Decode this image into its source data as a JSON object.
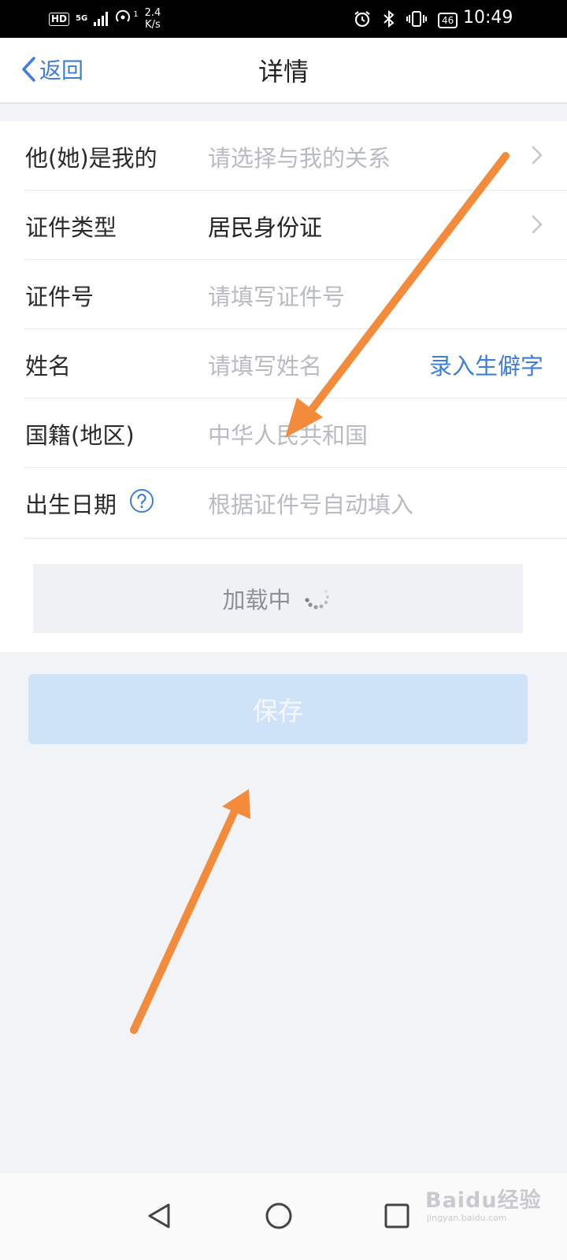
{
  "status_bar": {
    "hd_badge": "HD",
    "network": "5G",
    "signal_sub": "1",
    "speed_value": "2.4",
    "speed_unit": "K/s",
    "battery": "46",
    "time": "10:49"
  },
  "nav": {
    "back_label": "返回",
    "title": "详情"
  },
  "form": {
    "rows": [
      {
        "label": "他(她)是我的",
        "value": "请选择与我的关系",
        "value_state": "placeholder",
        "has_chevron": true
      },
      {
        "label": "证件类型",
        "value": "居民身份证",
        "value_state": "filled",
        "has_chevron": true
      },
      {
        "label": "证件号",
        "value": "请填写证件号",
        "value_state": "placeholder"
      },
      {
        "label": "姓名",
        "value": "请填写姓名",
        "value_state": "placeholder",
        "action": "录入生僻字"
      },
      {
        "label": "国籍(地区)",
        "value": "中华人民共和国",
        "value_state": "placeholder"
      },
      {
        "label": "出生日期",
        "value": "根据证件号自动填入",
        "value_state": "placeholder",
        "has_help": true
      }
    ],
    "loading_text": "加载中"
  },
  "save_label": "保存",
  "watermark": {
    "main": "Baidu经验",
    "sub": "jingyan.baidu.com"
  },
  "colors": {
    "accent": "#3d7fd6",
    "annotation_arrow": "#f28c3c",
    "save_disabled_bg": "#cfe3f8",
    "page_bg": "#f2f3f7"
  },
  "icons": {
    "back": "chevron-left-icon",
    "row_more": "chevron-right-icon",
    "help": "question-circle-icon",
    "spinner": "loading-spinner-icon",
    "sys_back": "triangle-back-icon",
    "sys_home": "circle-home-icon",
    "sys_recent": "square-recent-icon"
  }
}
